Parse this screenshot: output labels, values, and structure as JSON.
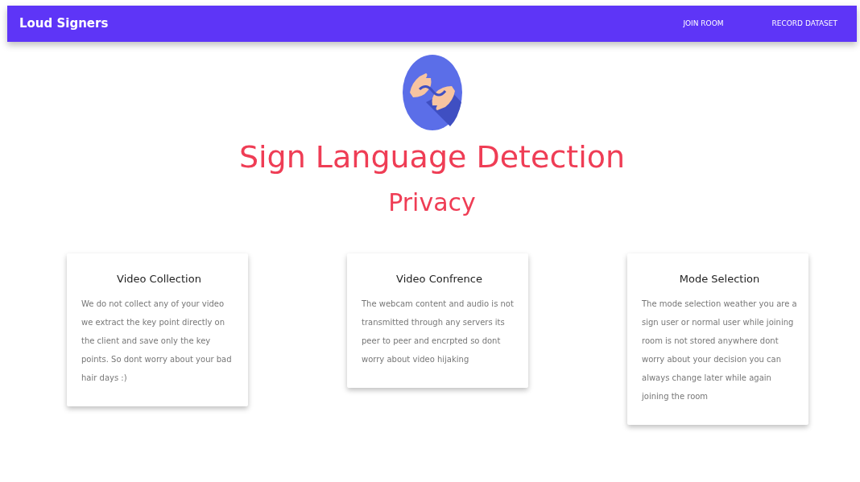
{
  "navbar": {
    "brand": "Loud Signers",
    "links": [
      "JOIN ROOM",
      "RECORD DATASET"
    ]
  },
  "title": "Sign Language Detection",
  "subtitle": "Privacy",
  "cards": [
    {
      "title": "Video Collection",
      "text": "We do not collect any of your video we extract the key point directly on the client and save only the key points. So dont worry about your bad hair days :)"
    },
    {
      "title": "Video Confrence",
      "text": "The webcam content and audio is not transmitted through any servers its peer to peer and encrpted so dont worry about video hijaking"
    },
    {
      "title": "Mode Selection",
      "text": "The mode selection weather you are a sign user or normal user while joining room is not stored anywhere dont worry about your decision you can always change later while again joining the room"
    }
  ]
}
